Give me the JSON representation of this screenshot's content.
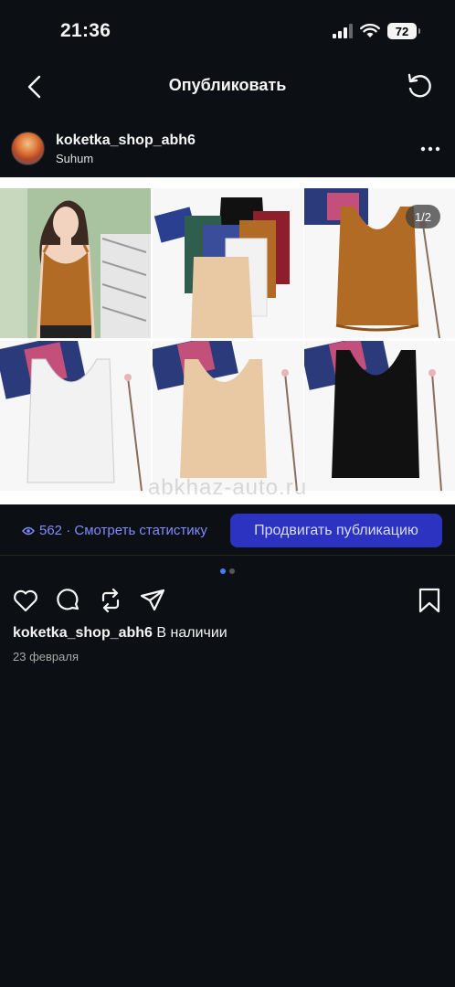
{
  "status_bar": {
    "time": "21:36",
    "battery": "72"
  },
  "nav": {
    "title": "Опубликовать"
  },
  "post": {
    "username": "koketka_shop_abh6",
    "location": "Suhum",
    "photo_counter": "1/2",
    "watermark": "abkhaz-auto.ru"
  },
  "stats": {
    "views_text": "562 · Смотреть статистику",
    "promote_label": "Продвигать публикацию"
  },
  "carousel": {
    "current_index": 1,
    "total": 2
  },
  "caption": {
    "username": "koketka_shop_abh6",
    "text": "В наличии",
    "date": "23 февраля"
  },
  "colors": {
    "background": "#0c1014",
    "accent_link": "#7f8cff",
    "promote_button": "#2b33c0",
    "active_dot": "#3d7cff",
    "product_colors": [
      "#b26b24",
      "#f2f2f2",
      "#e8c9a4",
      "#111111",
      "#2f5d4e",
      "#8c1f2b"
    ]
  }
}
